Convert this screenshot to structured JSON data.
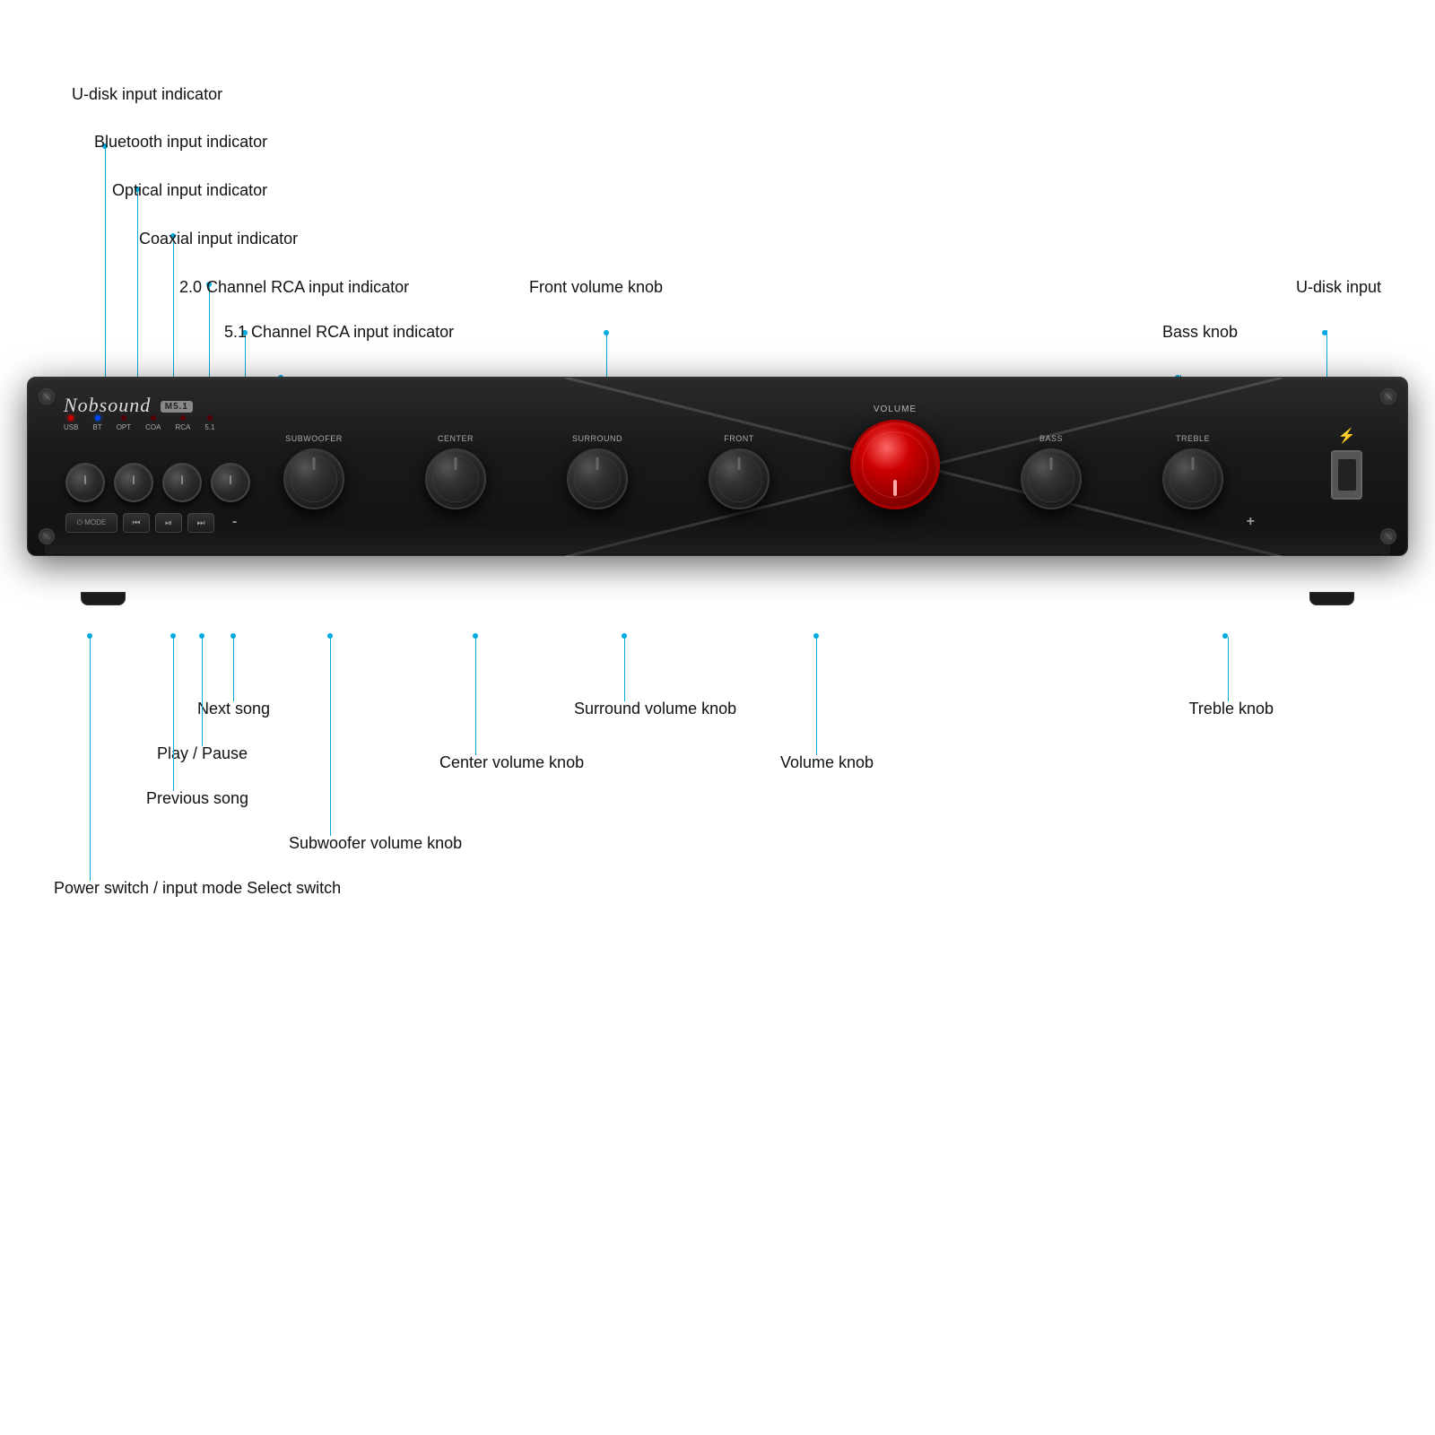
{
  "device": {
    "brand": "Nobsound",
    "model": "M5.1",
    "indicators": [
      {
        "label": "USB",
        "color": "red"
      },
      {
        "label": "BT",
        "color": "blue"
      },
      {
        "label": "OPT",
        "color": "red"
      },
      {
        "label": "COA",
        "color": "red"
      },
      {
        "label": "RCA",
        "color": "red"
      },
      {
        "label": "5.1",
        "color": "red"
      }
    ],
    "knobs": [
      {
        "id": "subwoofer",
        "label": "SUBWOOFER"
      },
      {
        "id": "center",
        "label": "CENTER"
      },
      {
        "id": "surround",
        "label": "SURROUND"
      },
      {
        "id": "front",
        "label": "FRONT"
      },
      {
        "id": "volume",
        "label": "VOLUME",
        "size": "large"
      },
      {
        "id": "bass",
        "label": "BASS"
      },
      {
        "id": "treble",
        "label": "TREBLE"
      }
    ],
    "transport": [
      "prev",
      "play-pause",
      "next"
    ],
    "minus": "-",
    "plus": "+"
  },
  "annotations": {
    "u_disk_input_indicator": "U-disk input indicator",
    "bluetooth_input_indicator": "Bluetooth input indicator",
    "optical_input_indicator": "Optical input indicator",
    "coaxial_input_indicator": "Coaxial input indicator",
    "rca_20_indicator": "2.0 Channel RCA input indicator",
    "rca_51_indicator": "5.1 Channel RCA input indicator",
    "front_volume_knob": "Front volume knob",
    "u_disk_input": "U-disk input",
    "bass_knob": "Bass knob",
    "next_song": "Next song",
    "play_pause": "Play / Pause",
    "previous_song": "Previous song",
    "subwoofer_volume_knob": "Subwoofer volume knob",
    "center_volume_knob": "Center volume knob",
    "surround_volume_knob": "Surround volume knob",
    "volume_knob": "Volume knob",
    "treble_knob": "Treble knob",
    "power_switch": "Power switch / input mode Select switch"
  }
}
